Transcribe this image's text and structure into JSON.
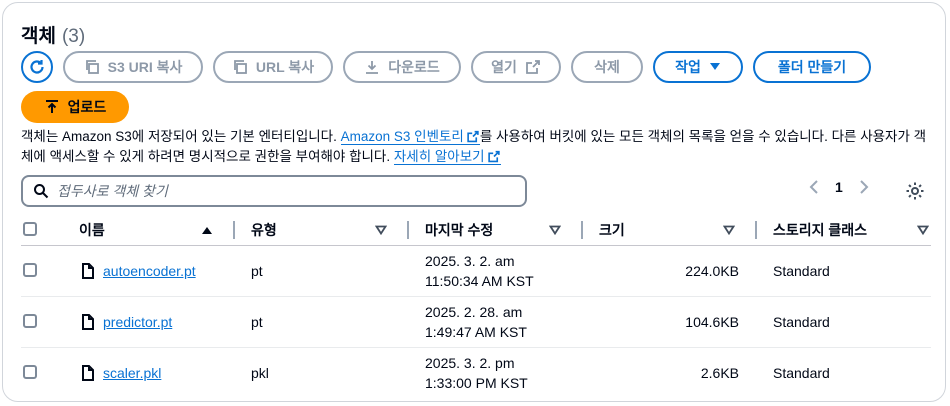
{
  "header": {
    "title": "객체",
    "count": "(3)"
  },
  "toolbar": {
    "s3_uri_copy": "S3 URI 복사",
    "url_copy": "URL 복사",
    "download": "다운로드",
    "open": "열기",
    "delete": "삭제",
    "actions": "작업",
    "create_folder": "폴더 만들기",
    "upload": "업로드"
  },
  "description": {
    "part1": "객체는 Amazon S3에 저장되어 있는 기본 엔터티입니다.",
    "link1": "Amazon S3 인벤토리",
    "part2": "를 사용하여 버킷에 있는 모든 객체의 목록을 얻을 수 있습니다. 다른 사용자가 객체에 액세스할 수 있게 하려면 명시적으로 권한을 부여해야 합니다.",
    "link2": "자세히 알아보기"
  },
  "search": {
    "placeholder": "접두사로 객체 찾기"
  },
  "pagination": {
    "page": "1"
  },
  "columns": {
    "name": "이름",
    "type": "유형",
    "modified": "마지막 수정",
    "size": "크기",
    "storage_class": "스토리지 클래스"
  },
  "rows": [
    {
      "name": "autoencoder.pt",
      "type": "pt",
      "modified_line1": "2025. 3. 2. am",
      "modified_line2": "11:50:34 AM KST",
      "size": "224.0KB",
      "storage_class": "Standard"
    },
    {
      "name": "predictor.pt",
      "type": "pt",
      "modified_line1": "2025. 2. 28. am",
      "modified_line2": "1:49:47 AM KST",
      "size": "104.6KB",
      "storage_class": "Standard"
    },
    {
      "name": "scaler.pkl",
      "type": "pkl",
      "modified_line1": "2025. 3. 2. pm",
      "modified_line2": "1:33:00 PM KST",
      "size": "2.6KB",
      "storage_class": "Standard"
    }
  ],
  "colors": {
    "accent": "#0972d3",
    "upload": "#ff9900",
    "disabled": "#8d99a8"
  }
}
